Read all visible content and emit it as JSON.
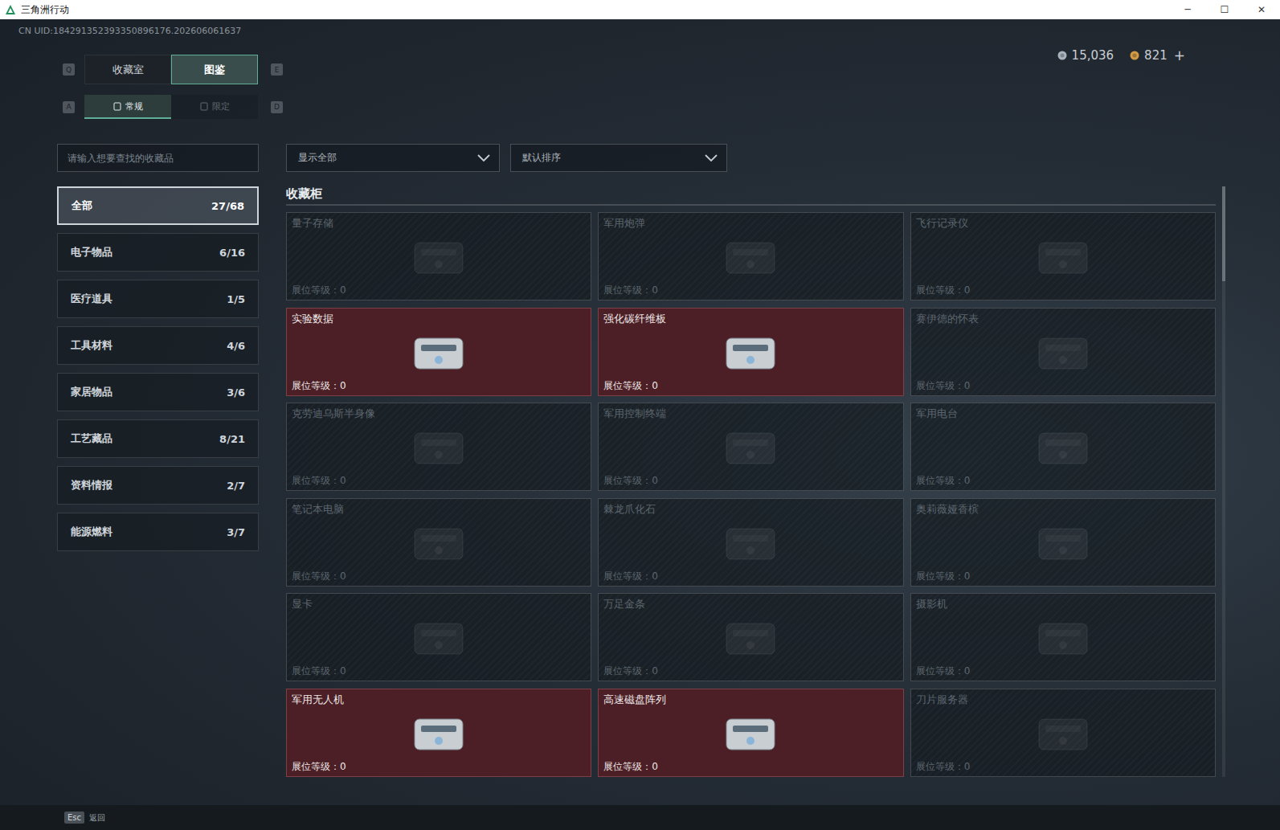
{
  "window": {
    "title": "三角洲行动",
    "controls": [
      "─",
      "☐",
      "✕"
    ]
  },
  "uid": "CN UID:184291352393350896176.202606061637",
  "tabs": {
    "prev_key": "Q",
    "next_key": "E",
    "items": [
      {
        "label": "收藏室",
        "selected": false
      },
      {
        "label": "图鉴",
        "selected": true
      }
    ]
  },
  "sub_tabs": {
    "prev_key": "A",
    "next_key": "D",
    "items": [
      {
        "label": "常规",
        "selected": true
      },
      {
        "label": "限定",
        "selected": false
      }
    ]
  },
  "currency": [
    {
      "amount": "15,036",
      "color": "#a9b3bd"
    },
    {
      "amount": "821",
      "color": "#d39a45"
    }
  ],
  "add_button": "+",
  "search": {
    "placeholder": "请输入想要查找的收藏品"
  },
  "filters": [
    {
      "label": "显示全部"
    },
    {
      "label": "默认排序"
    }
  ],
  "categories": [
    {
      "name": "全部",
      "count": "27/68",
      "selected": true
    },
    {
      "name": "电子物品",
      "count": "6/16",
      "selected": false
    },
    {
      "name": "医疗道具",
      "count": "1/5",
      "selected": false
    },
    {
      "name": "工具材料",
      "count": "4/6",
      "selected": false
    },
    {
      "name": "家居物品",
      "count": "3/6",
      "selected": false
    },
    {
      "name": "工艺藏品",
      "count": "8/21",
      "selected": false
    },
    {
      "name": "资料情报",
      "count": "2/7",
      "selected": false
    },
    {
      "name": "能源燃料",
      "count": "3/7",
      "selected": false
    }
  ],
  "section": {
    "title": "收藏柜"
  },
  "items": [
    {
      "name": "量子存储",
      "level_label": "展位等级：",
      "level": "0",
      "owned": false
    },
    {
      "name": "军用炮弹",
      "level_label": "展位等级：",
      "level": "0",
      "owned": false
    },
    {
      "name": "飞行记录仪",
      "level_label": "展位等级：",
      "level": "0",
      "owned": false
    },
    {
      "name": "实验数据",
      "level_label": "展位等级：",
      "level": "0",
      "owned": true
    },
    {
      "name": "强化碳纤维板",
      "level_label": "展位等级：",
      "level": "0",
      "owned": true
    },
    {
      "name": "赛伊德的怀表",
      "level_label": "展位等级：",
      "level": "0",
      "owned": false
    },
    {
      "name": "克劳迪乌斯半身像",
      "level_label": "展位等级：",
      "level": "0",
      "owned": false
    },
    {
      "name": "军用控制终端",
      "level_label": "展位等级：",
      "level": "0",
      "owned": false
    },
    {
      "name": "军用电台",
      "level_label": "展位等级：",
      "level": "0",
      "owned": false
    },
    {
      "name": "笔记本电脑",
      "level_label": "展位等级：",
      "level": "0",
      "owned": false
    },
    {
      "name": "棘龙爪化石",
      "level_label": "展位等级：",
      "level": "0",
      "owned": false
    },
    {
      "name": "奥莉薇娅香槟",
      "level_label": "展位等级：",
      "level": "0",
      "owned": false
    },
    {
      "name": "显卡",
      "level_label": "展位等级：",
      "level": "0",
      "owned": false
    },
    {
      "name": "万足金条",
      "level_label": "展位等级：",
      "level": "0",
      "owned": false
    },
    {
      "name": "摄影机",
      "level_label": "展位等级：",
      "level": "0",
      "owned": false
    },
    {
      "name": "军用无人机",
      "level_label": "展位等级：",
      "level": "0",
      "owned": true
    },
    {
      "name": "高速磁盘阵列",
      "level_label": "展位等级：",
      "level": "0",
      "owned": true
    },
    {
      "name": "刀片服务器",
      "level_label": "展位等级：",
      "level": "0",
      "owned": false
    }
  ],
  "scrollbar": {
    "level": 0.16
  },
  "footer": {
    "key": "Esc",
    "label": "返回"
  }
}
